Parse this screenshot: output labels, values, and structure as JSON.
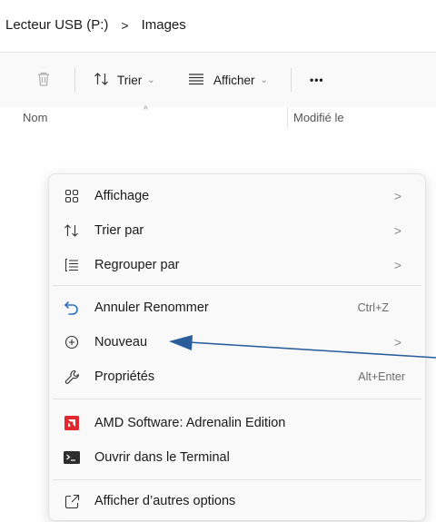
{
  "breadcrumb": {
    "drive": "Lecteur USB (P:)",
    "separator": ">",
    "folder": "Images"
  },
  "toolbar": {
    "delete_icon": "trash-icon",
    "sort_label": "Trier",
    "view_label": "Afficher",
    "more_label": "•••"
  },
  "columns": {
    "name": "Nom",
    "modified": "Modifié le"
  },
  "context_menu": {
    "items": [
      {
        "label": "Affichage",
        "icon": "grid-icon",
        "submenu": true
      },
      {
        "label": "Trier par",
        "icon": "sort-icon",
        "submenu": true
      },
      {
        "label": "Regrouper par",
        "icon": "group-icon",
        "submenu": true
      },
      {
        "label": "Annuler Renommer",
        "icon": "undo-icon",
        "shortcut": "Ctrl+Z"
      },
      {
        "label": "Nouveau",
        "icon": "plus-circle-icon",
        "submenu": true
      },
      {
        "label": "Propriétés",
        "icon": "wrench-icon",
        "shortcut": "Alt+Enter"
      },
      {
        "label": "AMD Software: Adrenalin Edition",
        "icon": "amd-icon"
      },
      {
        "label": "Ouvrir dans le Terminal",
        "icon": "terminal-icon"
      },
      {
        "label": "Afficher d’autres options",
        "icon": "share-icon"
      }
    ],
    "chevron": ">"
  },
  "colors": {
    "arrow": "#2b5d9b",
    "amd_red": "#e0282e",
    "icon_dark": "#333333"
  }
}
